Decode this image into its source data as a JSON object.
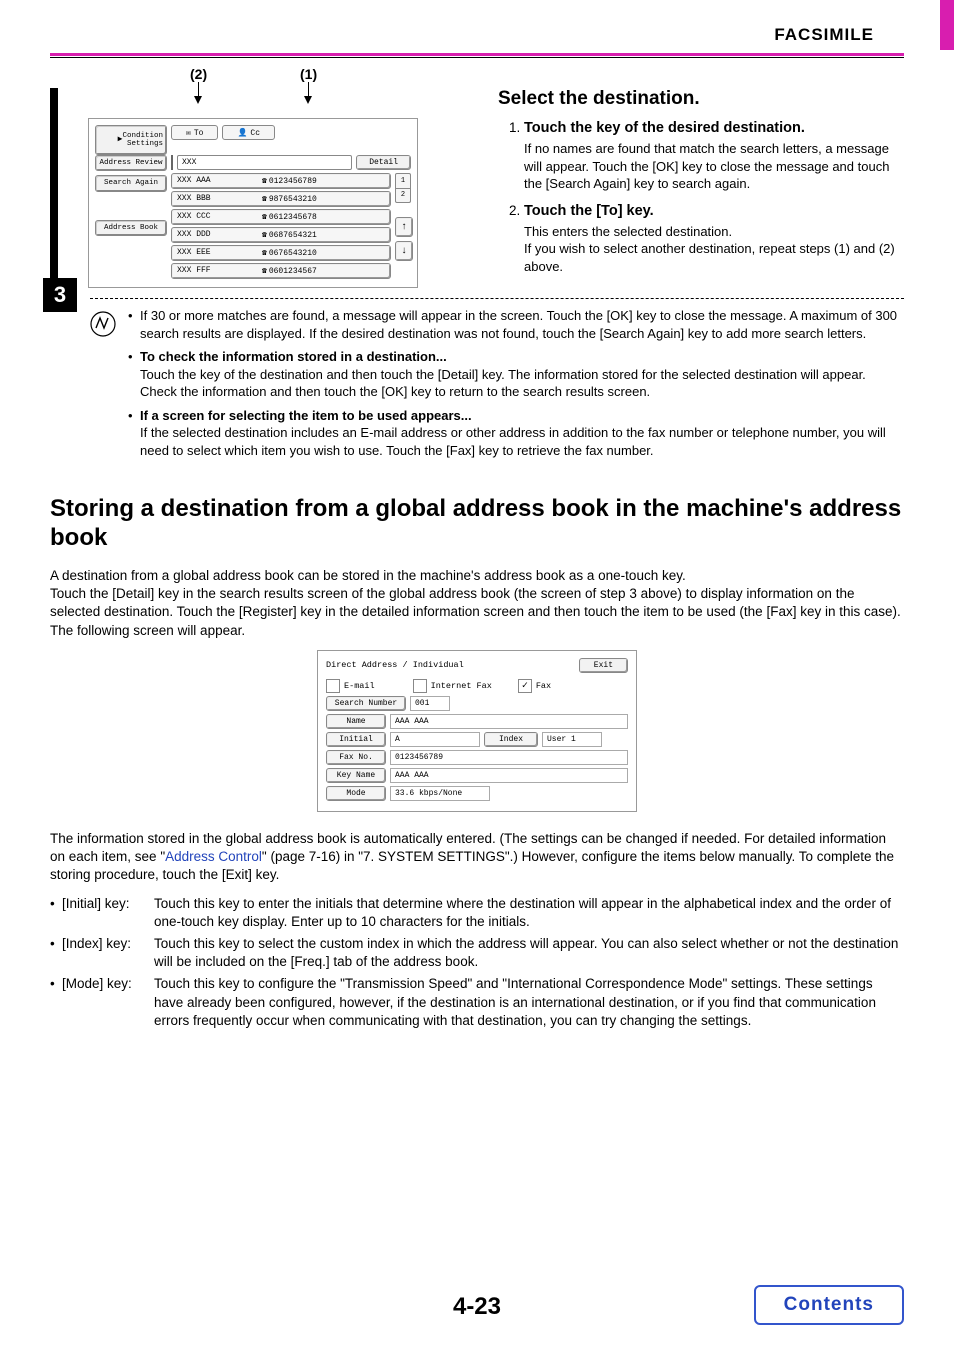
{
  "header": {
    "category": "FACSIMILE"
  },
  "step": {
    "number": "3",
    "callouts": {
      "c1": "(1)",
      "c2": "(2)"
    },
    "title": "Select the destination.",
    "items": [
      {
        "num": "(1)",
        "heading": "Touch the key of the desired destination.",
        "body": "If no names are found that match the search letters, a message will appear. Touch the [OK] key to close the message and touch the [Search Again] key to search again."
      },
      {
        "num": "(2)",
        "heading": "Touch the [To] key.",
        "body": "This enters the selected destination.\nIf you wish to select another destination, repeat steps (1) and (2) above."
      }
    ]
  },
  "ui_panel_1": {
    "tabs": {
      "to": "To",
      "cc": "Cc"
    },
    "sidebar": {
      "condition": "Condition\nSettings",
      "address_review": "Address Review",
      "search_again": "Search Again",
      "address_book": "Address Book"
    },
    "search_text": "XXX",
    "detail_btn": "Detail",
    "page_indicator": {
      "cur": "1",
      "total": "2"
    },
    "scroll_up": "↑",
    "scroll_down": "↓",
    "rows": [
      {
        "name": "XXX AAA",
        "num": "0123456789"
      },
      {
        "name": "XXX BBB",
        "num": "9876543210"
      },
      {
        "name": "XXX CCC",
        "num": "0612345678"
      },
      {
        "name": "XXX DDD",
        "num": "0687654321"
      },
      {
        "name": "XXX EEE",
        "num": "0676543210"
      },
      {
        "name": "XXX FFF",
        "num": "0601234567"
      }
    ]
  },
  "notes": [
    {
      "body": "If 30 or more matches are found, a message will appear in the screen. Touch the [OK] key to close the message. A maximum of 300 search results are displayed. If the desired destination was not found, touch the [Search Again] key to add more search letters."
    },
    {
      "heading": "To check the information stored in a destination...",
      "body": "Touch the key of the destination and then touch the [Detail] key. The information stored for the selected destination will appear. Check the information and then touch the [OK] key to return to the search results screen."
    },
    {
      "heading": "If a screen for selecting the item to be used appears...",
      "body": "If the selected destination includes an E-mail address or other address in addition to the fax number or telephone number, you will need to select which item you wish to use. Touch the [Fax] key to retrieve the fax number."
    }
  ],
  "section": {
    "title": "Storing a destination from a global address book in the machine's address book",
    "p1": "A destination from a global address book can be stored in the machine's address book as a one-touch key.\nTouch the [Detail] key in the search results screen of the global address book (the screen of step 3 above) to display information on the selected destination. Touch the [Register] key in the detailed information screen and then touch the item to be used (the [Fax] key in this case). The following screen will appear.",
    "p2a": "The information stored in the global address book is automatically entered. (The settings can be changed if needed. For detailed information on each item, see \"",
    "p2_link": "Address Control",
    "p2b": "\" (page 7-16) in \"7. SYSTEM SETTINGS\".) However, configure the items below manually. To complete the storing procedure, touch the [Exit] key."
  },
  "ui_panel_2": {
    "title": "Direct Address / Individual",
    "exit": "Exit",
    "email": "E-mail",
    "ifax": "Internet Fax",
    "fax": "Fax",
    "labels": {
      "search_number": "Search Number",
      "name": "Name",
      "initial": "Initial",
      "index": "Index",
      "fax_no": "Fax No.",
      "key_name": "Key Name",
      "mode": "Mode"
    },
    "values": {
      "search_number": "001",
      "name": "AAA AAA",
      "initial": "A",
      "index": "User 1",
      "fax_no": "0123456789",
      "key_name": "AAA AAA",
      "mode": "33.6 kbps/None"
    }
  },
  "defs": [
    {
      "label": "[Initial] key:",
      "body": "Touch this key to enter the initials that determine where the destination will appear in the alphabetical index and the order of one-touch key display. Enter up to 10 characters for the initials."
    },
    {
      "label": "[Index] key:",
      "body": "Touch this key to select the custom index in which the address will appear. You can also select whether or not the destination will be included on the [Freq.] tab of the address book."
    },
    {
      "label": "[Mode] key:",
      "body": "Touch this key to configure the \"Transmission Speed\" and \"International Correspondence Mode\" settings. These settings have already been configured, however, if the destination is an international destination, or if you find that communication errors frequently occur when communicating with that destination, you can try changing the settings."
    }
  ],
  "footer": {
    "page": "4-23",
    "contents": "Contents"
  }
}
